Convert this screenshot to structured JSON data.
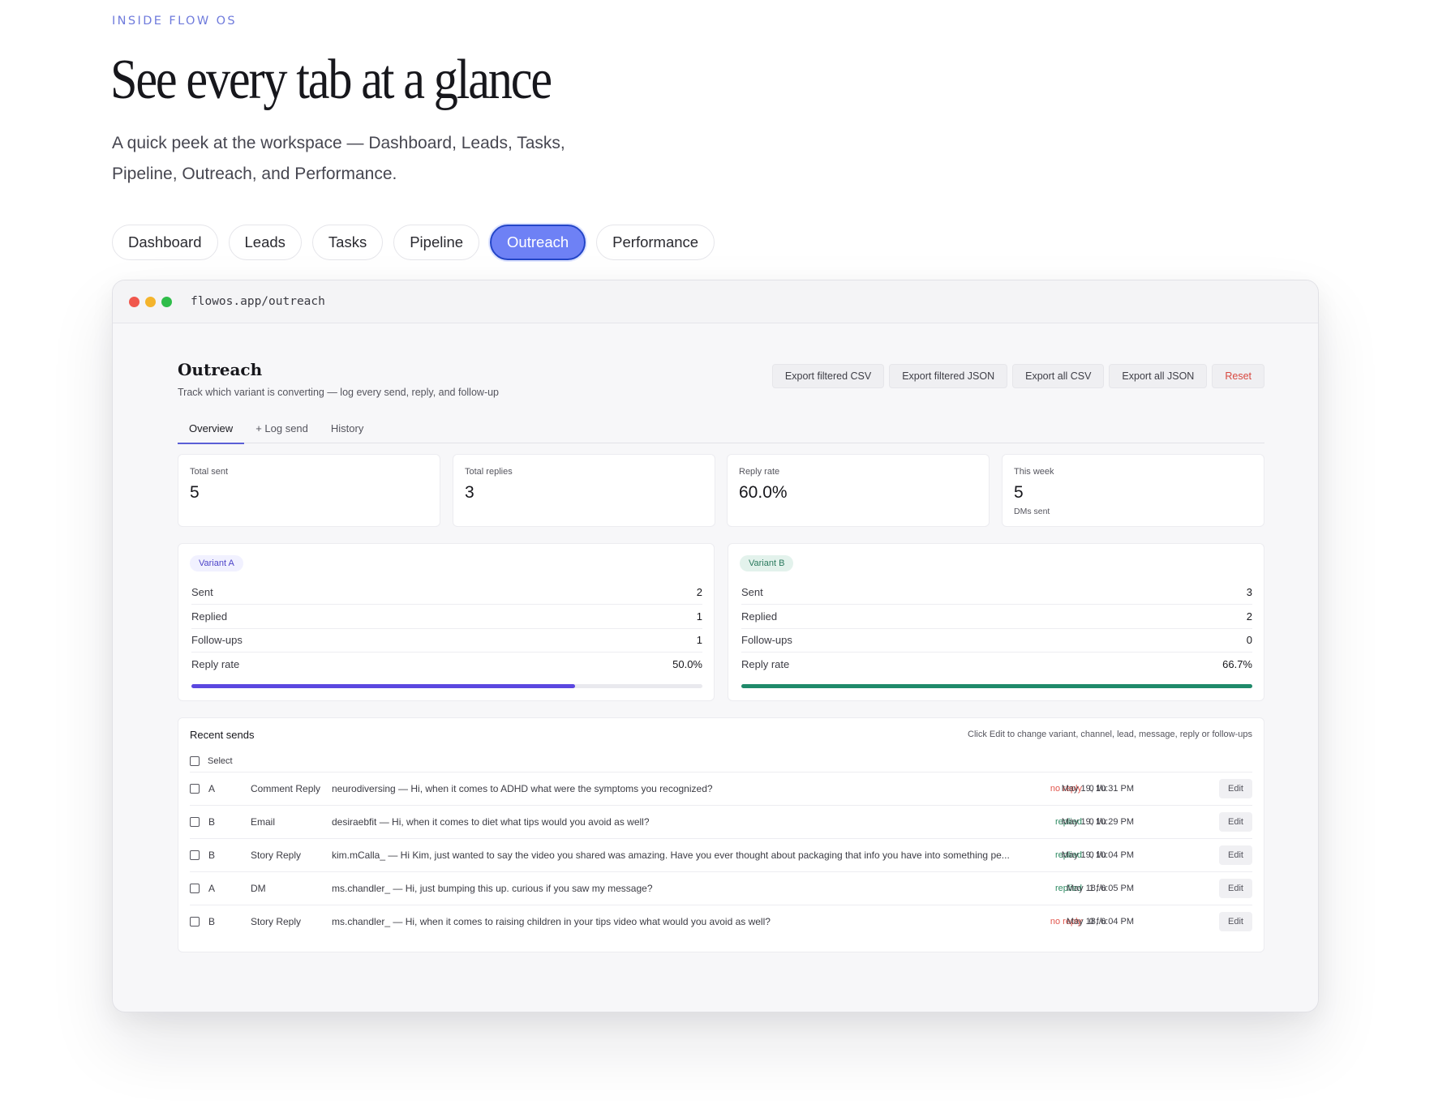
{
  "hero": {
    "eyebrow": "INSIDE FLOW OS",
    "headline": "See every tab at a glance",
    "lede": "A quick peek at the workspace — Dashboard, Leads, Tasks, Pipeline, Outreach, and Performance."
  },
  "tabs": [
    {
      "label": "Dashboard",
      "active": false
    },
    {
      "label": "Leads",
      "active": false
    },
    {
      "label": "Tasks",
      "active": false
    },
    {
      "label": "Pipeline",
      "active": false
    },
    {
      "label": "Outreach",
      "active": true
    },
    {
      "label": "Performance",
      "active": false
    }
  ],
  "window": {
    "url": "flowos.app/outreach",
    "traffic_lights": [
      "#f0574d",
      "#f4b42c",
      "#2fbd4a"
    ]
  },
  "outreach": {
    "title": "Outreach",
    "subtitle": "Track which variant is converting — log every send, reply, and follow-up",
    "actions": {
      "export_filtered_csv": "Export filtered CSV",
      "export_filtered_json": "Export filtered JSON",
      "export_all_csv": "Export all CSV",
      "export_all_json": "Export all JSON",
      "reset": "Reset"
    },
    "subtabs": {
      "overview": "Overview",
      "log_send": "+ Log send",
      "history": "History"
    },
    "stats": {
      "total_sent": {
        "label": "Total sent",
        "value": "5"
      },
      "total_replies": {
        "label": "Total replies",
        "value": "3"
      },
      "reply_rate": {
        "label": "Reply rate",
        "value": "60.0%"
      },
      "this_week": {
        "label": "This week",
        "value": "5",
        "note": "DMs sent"
      }
    },
    "variant_a": {
      "badge": "Variant A",
      "sent_label": "Sent",
      "sent": "2",
      "replied_label": "Replied",
      "replied": "1",
      "followups_label": "Follow-ups",
      "followups": "1",
      "rate_label": "Reply rate",
      "rate": "50.0%",
      "bar_fill": 0.75,
      "bar_color": "#5b47e0"
    },
    "variant_b": {
      "badge": "Variant B",
      "sent_label": "Sent",
      "sent": "3",
      "replied_label": "Replied",
      "replied": "2",
      "followups_label": "Follow-ups",
      "followups": "0",
      "rate_label": "Reply rate",
      "rate": "66.7%",
      "bar_fill": 1.0,
      "bar_color": "#1f8a6a"
    },
    "recent": {
      "title": "Recent sends",
      "hint": "Click Edit to change variant, channel, lead, message, reply or follow-ups",
      "select_label": "Select",
      "edit_label": "Edit",
      "rows": [
        {
          "variant": "A",
          "channel": "Comment Reply",
          "message": "neurodiversing — Hi, when it comes to ADHD what were the symptoms you recognized?",
          "status": "no reply",
          "followups": "0 f/u",
          "date": "May 19, 10:31 PM"
        },
        {
          "variant": "B",
          "channel": "Email",
          "message": "desiraebfit — Hi, when it comes to diet what tips would you avoid as well?",
          "status": "replied",
          "followups": "0 f/u",
          "date": "May 19, 10:29 PM"
        },
        {
          "variant": "B",
          "channel": "Story Reply",
          "message": "kim.mCalla_ — Hi Kim, just wanted to say the video you shared was amazing. Have you ever thought about packaging that info you have into something pe...",
          "status": "replied",
          "followups": "0 f/u",
          "date": "May 19, 10:04 PM"
        },
        {
          "variant": "A",
          "channel": "DM",
          "message": "ms.chandler_ — Hi, just bumping this up. curious if you saw my message?",
          "status": "replied",
          "followups": "1 f/u",
          "date": "May 18, 6:05 PM"
        },
        {
          "variant": "B",
          "channel": "Story Reply",
          "message": "ms.chandler_ — Hi, when it comes to raising children in your tips video what would you avoid as well?",
          "status": "no reply",
          "followups": "0 f/u",
          "date": "May 18, 6:04 PM"
        }
      ]
    }
  }
}
